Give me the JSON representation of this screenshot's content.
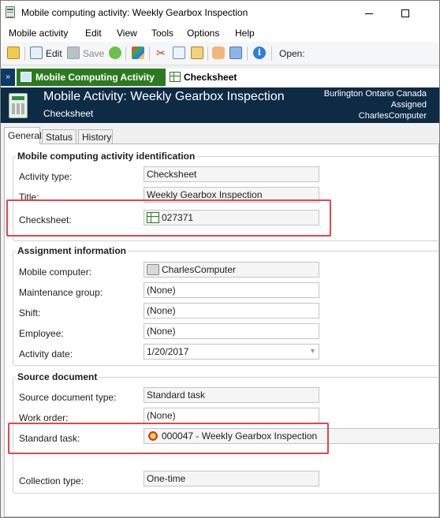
{
  "window": {
    "title": "Mobile computing activity: Weekly Gearbox Inspection",
    "minimize": "minimize",
    "maximize": "maximize"
  },
  "menu": [
    "Mobile activity",
    "Edit",
    "View",
    "Tools",
    "Options",
    "Help"
  ],
  "toolbar": {
    "edit_label": "Edit",
    "save_label": "Save",
    "open_label": "Open:"
  },
  "nav_tabs": {
    "tab1": "Mobile Computing Activity",
    "tab2": "Checksheet"
  },
  "header": {
    "title": "Mobile Activity: Weekly Gearbox Inspection",
    "subtitle": "Checksheet",
    "location": "Burlington Ontario Canada",
    "status": "Assigned",
    "computer": "CharlesComputer"
  },
  "content_tabs": [
    "General",
    "Status",
    "History"
  ],
  "identification": {
    "title": "Mobile computing activity identification",
    "activity_type_label": "Activity type:",
    "activity_type": "Checksheet",
    "title_label": "Title:",
    "title_value": "Weekly Gearbox Inspection",
    "checksheet_label": "Checksheet:",
    "checksheet_value": "027371"
  },
  "assignment": {
    "title": "Assignment information",
    "mobile_computer_label": "Mobile computer:",
    "mobile_computer": "CharlesComputer",
    "maintenance_group_label": "Maintenance group:",
    "maintenance_group": "(None)",
    "shift_label": "Shift:",
    "shift": "(None)",
    "employee_label": "Employee:",
    "employee": "(None)",
    "activity_date_label": "Activity date:",
    "activity_date": "1/20/2017"
  },
  "source": {
    "title": "Source document",
    "doc_type_label": "Source document type:",
    "doc_type": "Standard task",
    "work_order_label": "Work order:",
    "work_order": "(None)",
    "standard_task_label": "Standard task:",
    "standard_task": "000047 - Weekly Gearbox Inspection",
    "collection_type_label": "Collection type:",
    "collection_type": "One-time"
  },
  "colors": {
    "accent_green": "#2b7a1f",
    "header_navy": "#0d2b45",
    "highlight_red": "#e0474c"
  }
}
